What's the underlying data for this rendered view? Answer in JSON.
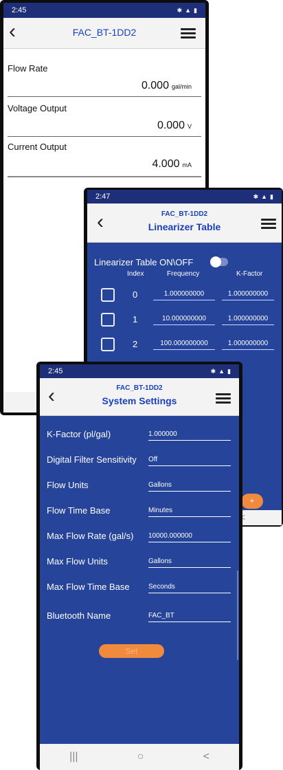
{
  "phone1": {
    "status_time": "2:45",
    "title": "FAC_BT-1DD2",
    "fields": [
      {
        "label": "Flow Rate",
        "value": "0.000",
        "unit": "gal/min"
      },
      {
        "label": "Voltage Output",
        "value": "0.000",
        "unit": "V"
      },
      {
        "label": "Current Output",
        "value": "4.000",
        "unit": "mA"
      }
    ]
  },
  "phone2": {
    "status_time": "2:47",
    "device": "FAC_BT-1DD2",
    "title": "Linearizer Table",
    "toggle_label": "Linearizer Table ON\\OFF",
    "headers": {
      "index": "Index",
      "frequency": "Frequency",
      "kfactor": "K-Factor"
    },
    "rows": [
      {
        "index": "0",
        "frequency": "1.000000000",
        "kfactor": "1.000000000"
      },
      {
        "index": "1",
        "frequency": "10.000000000",
        "kfactor": "1.000000000"
      },
      {
        "index": "2",
        "frequency": "100.000000000",
        "kfactor": "1.000000000"
      }
    ],
    "add_label": "+",
    "nav_back": "<"
  },
  "phone3": {
    "status_time": "2:45",
    "device": "FAC_BT-1DD2",
    "title": "System Settings",
    "settings": [
      {
        "label": "K-Factor (pl/gal)",
        "value": "1.000000"
      },
      {
        "label": "Digital Filter Sensitivity",
        "value": "Off"
      },
      {
        "label": "Flow Units",
        "value": "Gallons"
      },
      {
        "label": "Flow Time Base",
        "value": "Minutes"
      },
      {
        "label": "Max Flow Rate (gal/s)",
        "value": "10000.000000"
      },
      {
        "label": "Max Flow Units",
        "value": "Gallons"
      },
      {
        "label": "Max Flow Time Base",
        "value": "Seconds"
      },
      {
        "label": "Bluetooth Name",
        "value": "FAC_BT"
      }
    ],
    "set_label": "Set",
    "nav": {
      "recents": "|||",
      "home": "○",
      "back": "<"
    }
  },
  "colors": {
    "accent_blue": "#25449a",
    "title_blue": "#1a3fb8",
    "button_orange": "#f08a3c"
  }
}
